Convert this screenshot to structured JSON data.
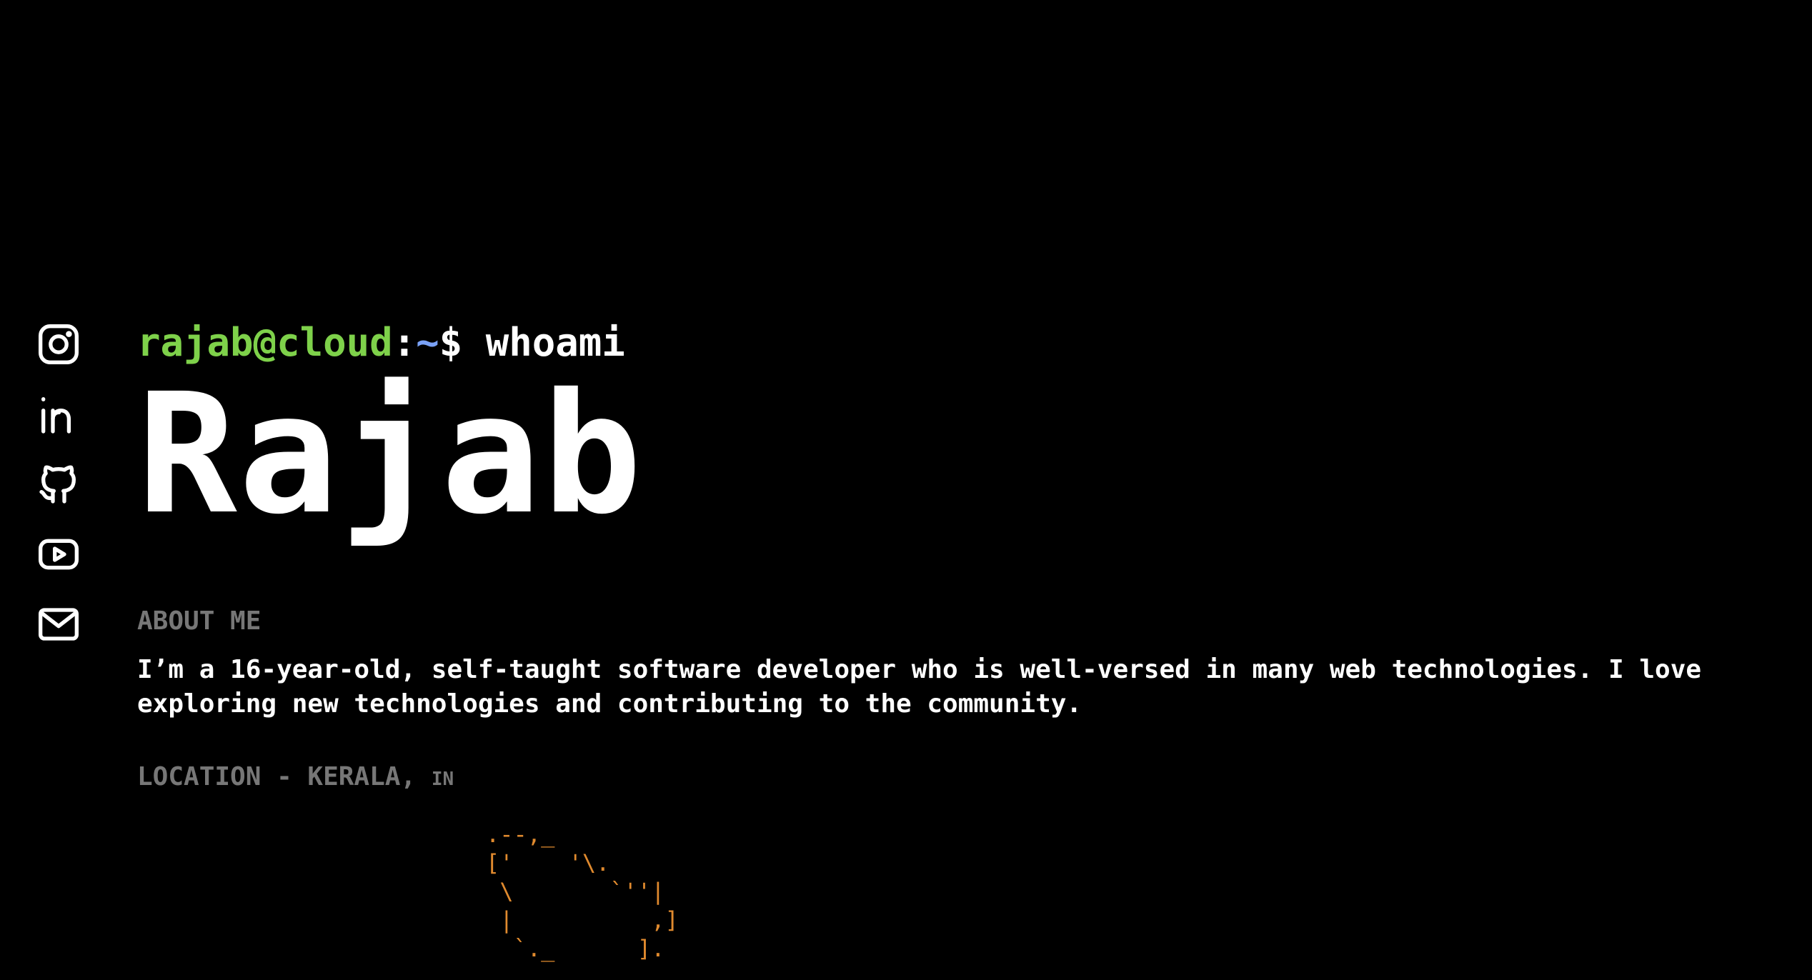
{
  "social": {
    "items": [
      {
        "name": "instagram",
        "icon": "instagram-icon"
      },
      {
        "name": "linkedin",
        "icon": "linkedin-icon"
      },
      {
        "name": "github",
        "icon": "github-icon"
      },
      {
        "name": "youtube",
        "icon": "youtube-icon"
      },
      {
        "name": "email",
        "icon": "mail-icon"
      }
    ]
  },
  "prompt": {
    "user_host": "rajab@cloud",
    "colon": ":",
    "path": "~",
    "dollar": "$",
    "command": "whoami"
  },
  "hero": {
    "name": "Rajab"
  },
  "about": {
    "heading": "ABOUT ME",
    "text": "I’m a 16-year-old, self-taught software developer who is well-versed in many web technologies. I love exploring new technologies and contributing to the community."
  },
  "location": {
    "label": "LOCATION - KERALA,",
    "country": "IN",
    "ascii_map": ".--,_\n['    '\\.\n \\       `''|\n |          ,]\n  `._      ]."
  },
  "colors": {
    "background": "#000000",
    "prompt_user": "#7ed14a",
    "prompt_path": "#7aa2f7",
    "muted": "#777777",
    "map": "#e08a2e"
  }
}
